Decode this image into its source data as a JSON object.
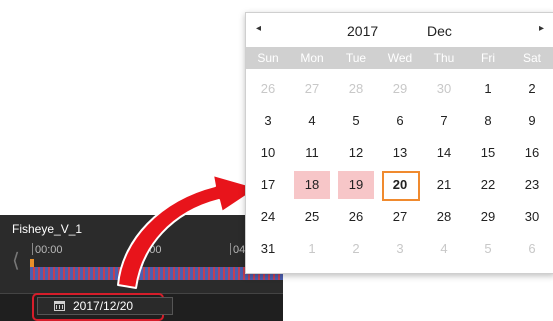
{
  "player": {
    "channel_name": "Fisheye_V_1",
    "time_labels": [
      "00:00",
      "02:00",
      "04"
    ],
    "date_value": "2017/12/20"
  },
  "calendar": {
    "prev_symbol": "◂",
    "next_symbol": "▸",
    "year": "2017",
    "month": "Dec",
    "weekdays": [
      "Sun",
      "Mon",
      "Tue",
      "Wed",
      "Thu",
      "Fri",
      "Sat"
    ],
    "weeks": [
      [
        {
          "d": "26",
          "o": true
        },
        {
          "d": "27",
          "o": true
        },
        {
          "d": "28",
          "o": true
        },
        {
          "d": "29",
          "o": true
        },
        {
          "d": "30",
          "o": true
        },
        {
          "d": "1"
        },
        {
          "d": "2"
        }
      ],
      [
        {
          "d": "3"
        },
        {
          "d": "4"
        },
        {
          "d": "5"
        },
        {
          "d": "6"
        },
        {
          "d": "7"
        },
        {
          "d": "8"
        },
        {
          "d": "9"
        }
      ],
      [
        {
          "d": "10"
        },
        {
          "d": "11"
        },
        {
          "d": "12"
        },
        {
          "d": "13"
        },
        {
          "d": "14"
        },
        {
          "d": "15"
        },
        {
          "d": "16"
        }
      ],
      [
        {
          "d": "17"
        },
        {
          "d": "18",
          "range": true
        },
        {
          "d": "19",
          "range": true
        },
        {
          "d": "20",
          "selected": true
        },
        {
          "d": "21"
        },
        {
          "d": "22"
        },
        {
          "d": "23"
        }
      ],
      [
        {
          "d": "24"
        },
        {
          "d": "25"
        },
        {
          "d": "26"
        },
        {
          "d": "27"
        },
        {
          "d": "28"
        },
        {
          "d": "29"
        },
        {
          "d": "30"
        }
      ],
      [
        {
          "d": "31"
        },
        {
          "d": "1",
          "o": true
        },
        {
          "d": "2",
          "o": true
        },
        {
          "d": "3",
          "o": true
        },
        {
          "d": "4",
          "o": true
        },
        {
          "d": "5",
          "o": true
        },
        {
          "d": "6",
          "o": true
        }
      ]
    ]
  },
  "colors": {
    "highlight_border": "#d61d2a",
    "arrow": "#e8141b",
    "range_fill": "#f7c6c8",
    "selected_border": "#f08a2e"
  },
  "icons": {
    "date_field": "calendar-icon",
    "prev": "chevron-left-icon",
    "next": "chevron-right-icon"
  }
}
